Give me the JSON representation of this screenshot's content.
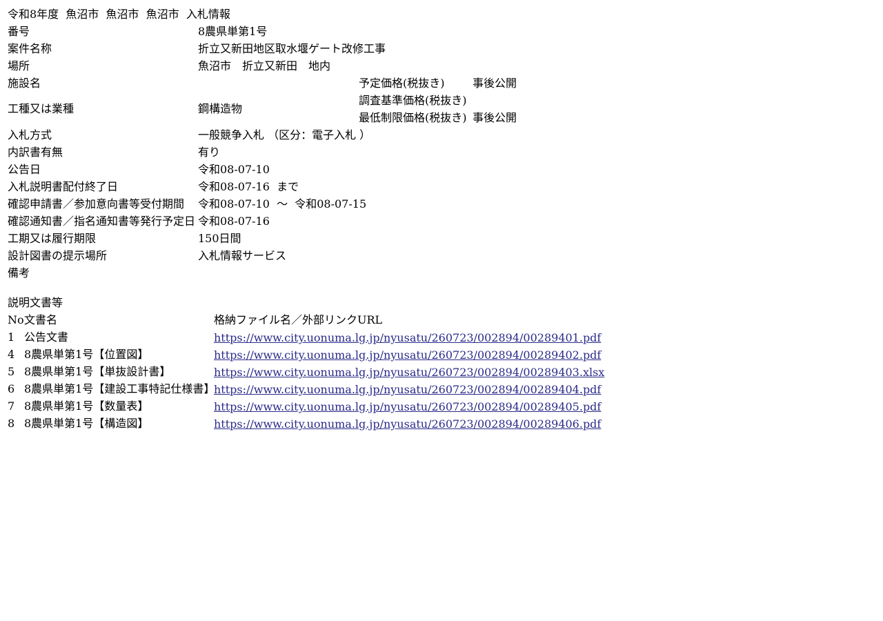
{
  "page_title": "令和8年度  魚沼市  魚沼市  魚沼市  入札情報",
  "details": {
    "number": {
      "label": "番号",
      "value": "8農県単第1号"
    },
    "case_name": {
      "label": "案件名称",
      "value": "折立又新田地区取水堰ゲート改修工事"
    },
    "location": {
      "label": "場所",
      "value": "魚沼市　折立又新田　地内"
    },
    "facility": {
      "label": "施設名",
      "value": ""
    },
    "work_type": {
      "label": "工種又は業種",
      "value": "鋼構造物"
    },
    "bid_method": {
      "label": "入札方式",
      "value": "一般競争入札 （区分：電子入札 ）"
    },
    "breakdown": {
      "label": "内訳書有無",
      "value": "有り"
    },
    "notice_date": {
      "label": "公告日",
      "value": "令和08-07-10"
    },
    "doc_distribution_end": {
      "label": "入札説明書配付終了日",
      "value": "令和08-07-16  まで"
    },
    "application_period": {
      "label": "確認申請書／参加意向書等受付期間",
      "value": "令和08-07-10  ～  令和08-07-15"
    },
    "notification_date": {
      "label": "確認通知書／指名通知書等発行予定日",
      "value": "令和08-07-16"
    },
    "construction_period": {
      "label": "工期又は履行期限",
      "value": "150日間"
    },
    "drawing_location": {
      "label": "設計図書の提示場所",
      "value": "入札情報サービス"
    },
    "remarks": {
      "label": "備考",
      "value": ""
    }
  },
  "prices": {
    "planned": {
      "label": "予定価格(税抜き)",
      "value": "事後公開"
    },
    "survey": {
      "label": "調査基準価格(税抜き)",
      "value": ""
    },
    "minimum": {
      "label": "最低制限価格(税抜き)",
      "value": "事後公開"
    }
  },
  "documents": {
    "section_title": "説明文書等",
    "header": {
      "no": "No",
      "name": "文書名",
      "file": "格納ファイル名／外部リンクURL"
    },
    "items": [
      {
        "no": "1",
        "name": "公告文書",
        "url": "https://www.city.uonuma.lg.jp/nyusatu/260723/002894/00289401.pdf"
      },
      {
        "no": "4",
        "name": "8農県単第1号【位置図】",
        "url": "https://www.city.uonuma.lg.jp/nyusatu/260723/002894/00289402.pdf"
      },
      {
        "no": "5",
        "name": "8農県単第1号【単抜設計書】",
        "url": "https://www.city.uonuma.lg.jp/nyusatu/260723/002894/00289403.xlsx"
      },
      {
        "no": "6",
        "name": "8農県単第1号【建設工事特記仕様書】",
        "url": "https://www.city.uonuma.lg.jp/nyusatu/260723/002894/00289404.pdf"
      },
      {
        "no": "7",
        "name": "8農県単第1号【数量表】",
        "url": "https://www.city.uonuma.lg.jp/nyusatu/260723/002894/00289405.pdf"
      },
      {
        "no": "8",
        "name": "8農県単第1号【構造図】",
        "url": "https://www.city.uonuma.lg.jp/nyusatu/260723/002894/00289406.pdf"
      }
    ]
  },
  "colors": {
    "link": "#2a2a8a",
    "text": "#000000",
    "background": "#ffffff"
  }
}
